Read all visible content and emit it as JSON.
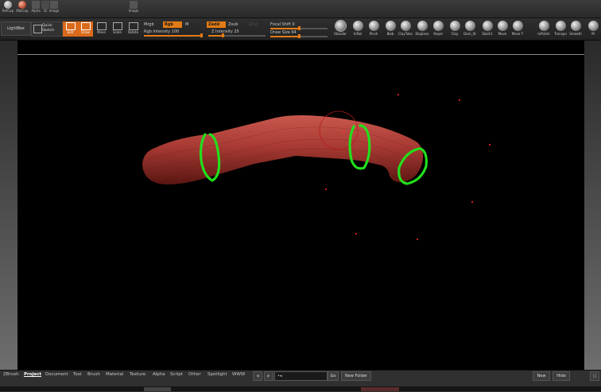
{
  "top_strip": {
    "items": [
      {
        "label": "RefCap",
        "icon": "matcap-ball-icon",
        "color": "#8a8a8a"
      },
      {
        "label": "MatCap",
        "icon": "matcap-red-icon",
        "color": "#c8553f"
      },
      {
        "label": "Alpha",
        "icon": "alpha-icon",
        "color": "#777777"
      },
      {
        "label": "3C",
        "icon": "texture-icon",
        "color": "#666666"
      },
      {
        "label": "Image",
        "icon": "image-icon",
        "color": "#6a6a6a"
      },
      {
        "label": "Image",
        "icon": "image-icon",
        "color": "#6a6a6a"
      }
    ]
  },
  "toolbar": {
    "lightbox": "LightBox",
    "quick_sketch": [
      "Quick",
      "Sketch"
    ],
    "tools": [
      {
        "label": "Edit",
        "active": true
      },
      {
        "label": "Draw",
        "active": true
      },
      {
        "label": "Move",
        "active": false
      },
      {
        "label": "Scale",
        "active": false
      },
      {
        "label": "Rotate",
        "active": false
      }
    ],
    "mrgb": {
      "label": "Mrgb",
      "active": false
    },
    "rgb": {
      "label": "Rgb",
      "active": true
    },
    "m": {
      "label": "M",
      "active": false
    },
    "rgb_intensity_label": "Rgb Intensity 100",
    "rgb_intensity_value": 100,
    "zadd": {
      "label": "Zadd",
      "active": true
    },
    "zsub": {
      "label": "Zsub",
      "active": false
    },
    "zcut": {
      "label": "Zcut",
      "active": false
    },
    "z_intensity_label": "Z Intensity 25",
    "z_intensity_value": 25,
    "focal_shift_label": "Focal Shift 0",
    "focal_shift_value": 0,
    "draw_size_label": "Draw Size 64",
    "draw_size_value": 64,
    "brushes": [
      "Standar",
      "Inflat",
      "Pinch",
      "Blob",
      "ClayTubs",
      "Displace",
      "Repel",
      "Clay",
      "Dam_St",
      "Slash1",
      "Move",
      "Move T",
      "mPolish",
      "Transpo",
      "Smooth",
      "M"
    ]
  },
  "scene": {
    "object_color": "#a83a33",
    "stroke_color": "#22e01c",
    "cursor_color": "#d01a1a"
  },
  "bottom": {
    "menus": [
      {
        "label": "ZBrush",
        "active": false
      },
      {
        "label": "Project",
        "active": true
      },
      {
        "label": "Document",
        "active": false
      },
      {
        "label": "Tool",
        "active": false
      },
      {
        "label": "Brush",
        "active": false
      },
      {
        "label": "Material",
        "active": false
      },
      {
        "label": "Texture",
        "active": false
      },
      {
        "label": "Alpha",
        "active": false
      },
      {
        "label": "Script",
        "active": false
      },
      {
        "label": "Other",
        "active": false
      },
      {
        "label": "Spotlight",
        "active": false
      },
      {
        "label": "WWW",
        "active": false
      }
    ],
    "path_value": "•◂",
    "go_label": "Go",
    "new_folder_label": "New Folder",
    "new_label": "New",
    "hide_label": "Hide"
  }
}
